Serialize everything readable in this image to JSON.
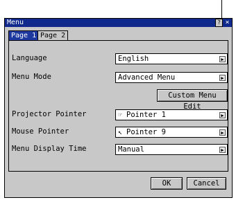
{
  "window": {
    "title": "Menu",
    "help_label": "?",
    "close_label": "×"
  },
  "tabs": [
    {
      "label": "Page 1",
      "active": true
    },
    {
      "label": "Page 2",
      "active": false
    }
  ],
  "rows": {
    "language": {
      "label": "Language",
      "value": "English"
    },
    "menu_mode": {
      "label": "Menu Mode",
      "value": "Advanced Menu"
    },
    "custom_menu_edit": {
      "label": "Custom Menu Edit"
    },
    "projector_pointer": {
      "label": "Projector Pointer",
      "value": "Pointer 1",
      "icon": "pointer-hand-icon"
    },
    "mouse_pointer": {
      "label": "Mouse Pointer",
      "value": "Pointer 9",
      "icon": "pointer-arrow-icon"
    },
    "menu_display_time": {
      "label": "Menu Display Time",
      "value": "Manual"
    }
  },
  "buttons": {
    "ok": "OK",
    "cancel": "Cancel"
  },
  "colors": {
    "title_bar": "#0f2a8c",
    "window_bg": "#c8c8c8",
    "active_tab": "#1e3aa0"
  }
}
